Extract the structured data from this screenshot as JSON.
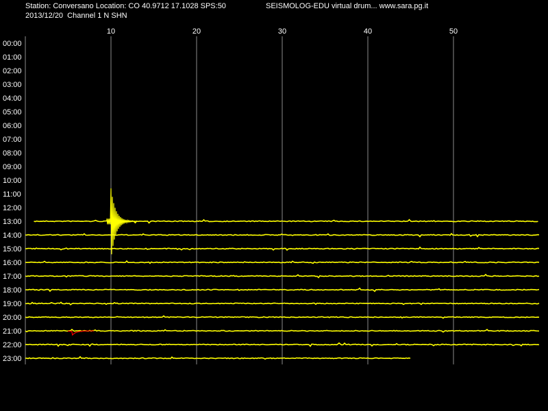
{
  "header": {
    "station_line": "Station: Conversano Location: CO 40.9712 17.1028 SPS:50",
    "title": "SEISMOLOG-EDU virtual drum... www.sara.pg.it",
    "date_line": "2013/12/20  Channel 1 N SHN"
  },
  "colors": {
    "background": "#000000",
    "trace": "#ffff00",
    "event": "#ff0000",
    "grid": "#8c8c8c",
    "text": "#ffffff"
  },
  "chart_data": {
    "type": "line",
    "xlabel": "",
    "ylabel": "",
    "x_ticks": [
      10,
      20,
      30,
      40,
      50
    ],
    "xlim": [
      0,
      60
    ],
    "grid": true,
    "y_labels": [
      "00:00",
      "01:00",
      "02:00",
      "03:00",
      "04:00",
      "05:00",
      "06:00",
      "07:00",
      "08:00",
      "09:00",
      "10:00",
      "11:00",
      "12:00",
      "13:00",
      "14:00",
      "15:00",
      "16:00",
      "17:00",
      "18:00",
      "19:00",
      "20:00",
      "21:00",
      "22:00",
      "23:00"
    ],
    "traces": [
      {
        "hour": "13:00",
        "start_min": 1,
        "end_min": 60
      },
      {
        "hour": "14:00",
        "start_min": 0,
        "end_min": 60
      },
      {
        "hour": "15:00",
        "start_min": 0,
        "end_min": 60
      },
      {
        "hour": "16:00",
        "start_min": 0,
        "end_min": 60
      },
      {
        "hour": "17:00",
        "start_min": 0,
        "end_min": 60
      },
      {
        "hour": "18:00",
        "start_min": 0,
        "end_min": 60
      },
      {
        "hour": "19:00",
        "start_min": 0,
        "end_min": 60
      },
      {
        "hour": "20:00",
        "start_min": 0,
        "end_min": 60
      },
      {
        "hour": "21:00",
        "start_min": 0,
        "end_min": 60
      },
      {
        "hour": "22:00",
        "start_min": 0,
        "end_min": 60
      },
      {
        "hour": "23:00",
        "start_min": 0,
        "end_min": 45
      }
    ],
    "events": [
      {
        "hour": "13:00",
        "minute": 10,
        "duration_min": 3,
        "amplitude_up_rows": 2.4,
        "amplitude_down_rows": 2.8,
        "color": "trace"
      },
      {
        "hour": "21:00",
        "minute": 5.5,
        "duration_min": 2.5,
        "amplitude_up_rows": 0.3,
        "amplitude_down_rows": 0.3,
        "color": "event"
      }
    ]
  }
}
